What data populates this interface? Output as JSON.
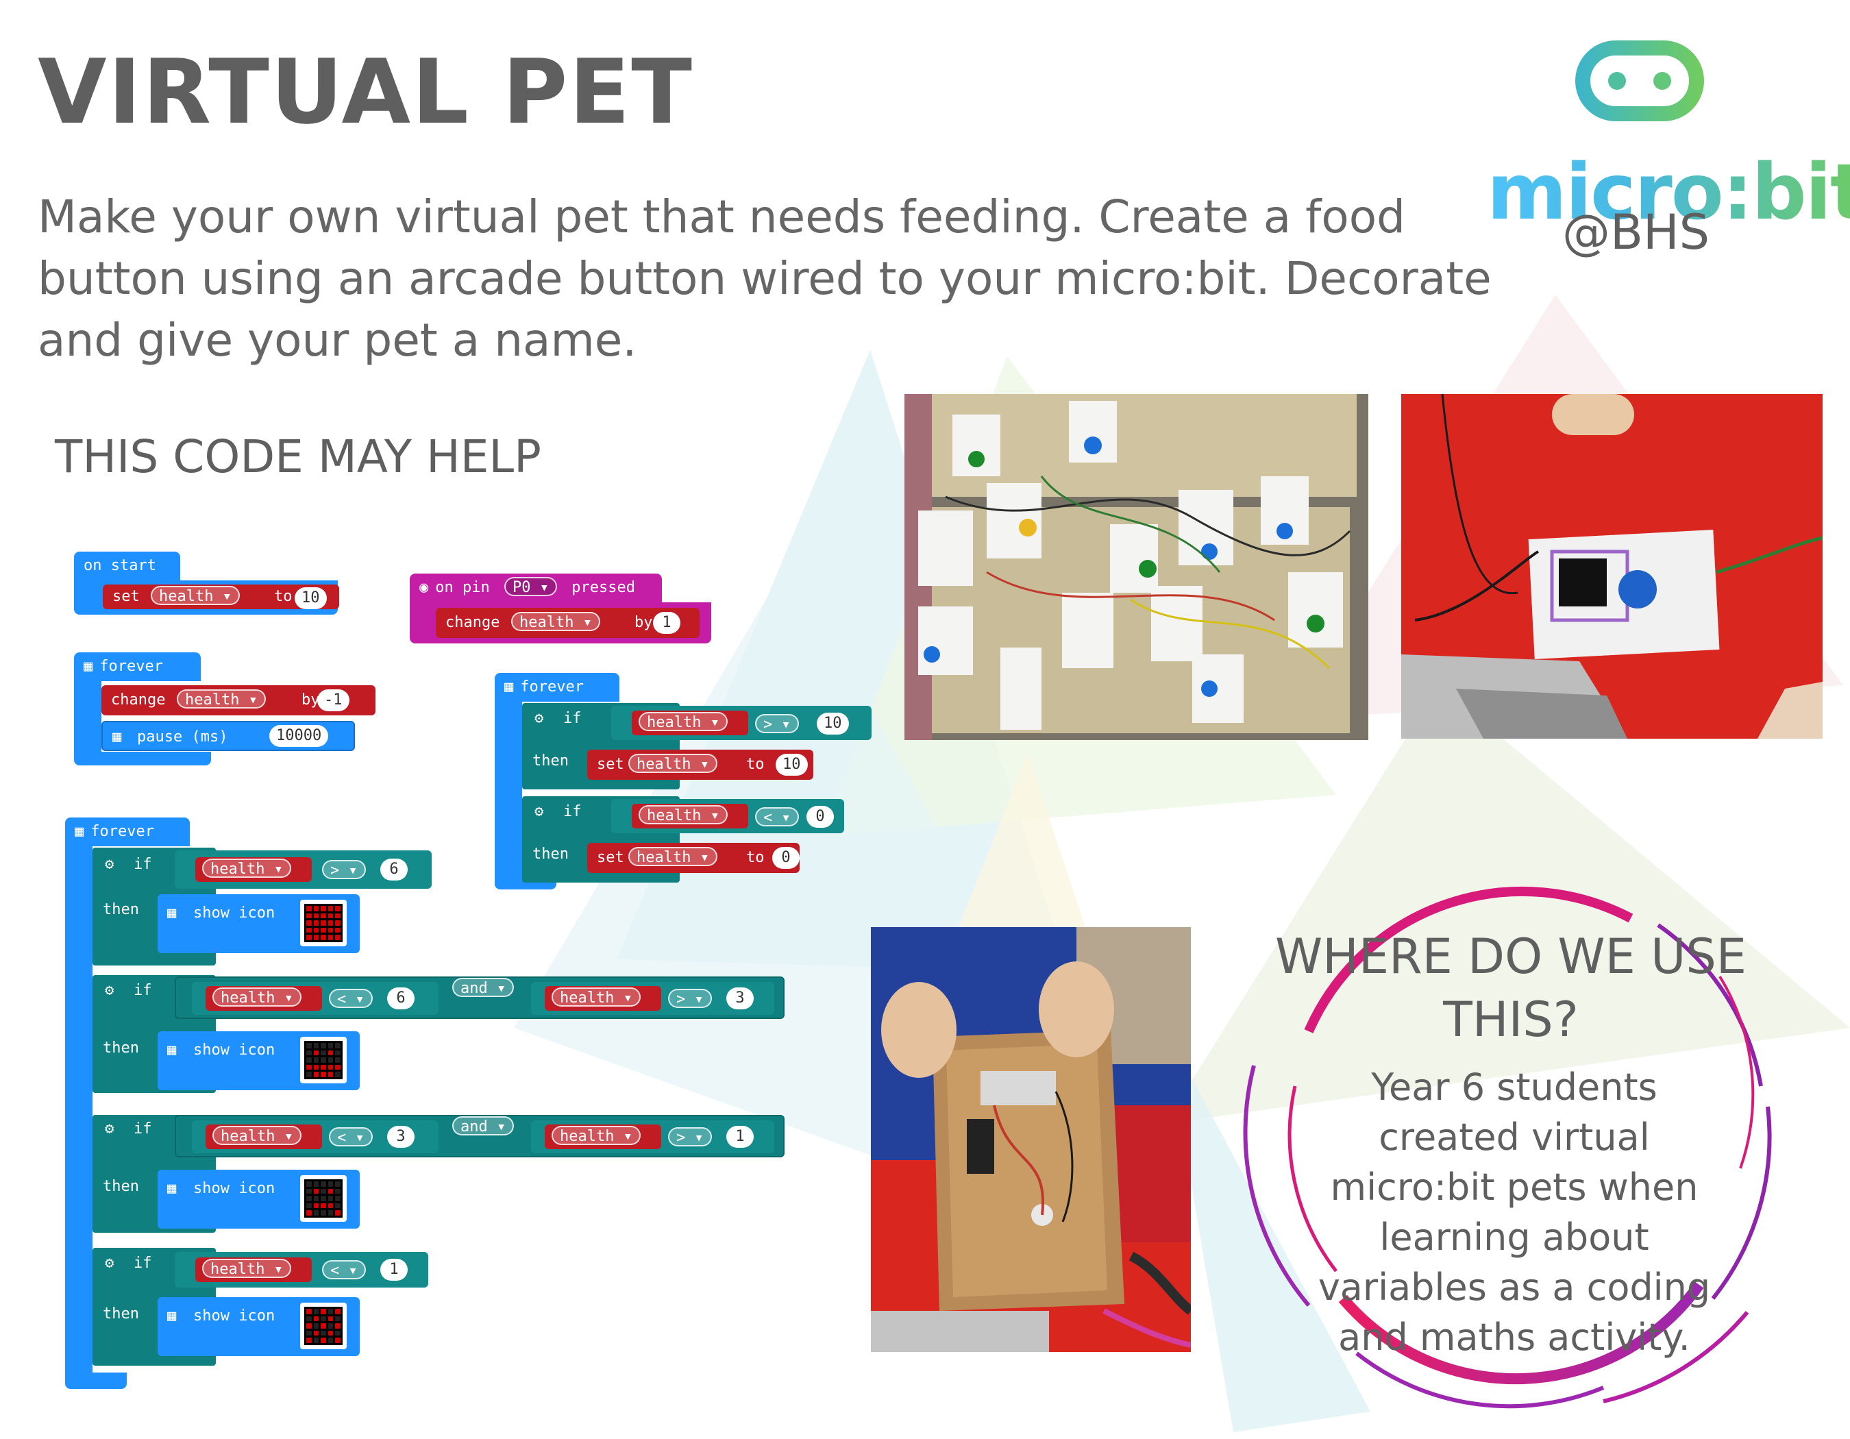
{
  "header": {
    "title": "VIRTUAL PET",
    "intro": "Make your own virtual pet that needs feeding. Create a food button using an arcade button wired to your micro:bit. Decorate and give your pet a name.",
    "help_heading": "THIS CODE MAY HELP"
  },
  "logo": {
    "wordmark": "micro:bit",
    "handle": "@BHS"
  },
  "code": {
    "on_start": {
      "hat": "on start",
      "set": "set",
      "var": "health ▾",
      "to": "to",
      "value": "10"
    },
    "forever_1": {
      "hat": "forever",
      "change": "change",
      "var": "health ▾",
      "by": "by",
      "value": "-1",
      "pause": "pause (ms)",
      "pause_value": "10000"
    },
    "on_pin": {
      "hat": "on pin",
      "pin": "P0 ▾",
      "pressed": "pressed",
      "change": "change",
      "var": "health ▾",
      "by": "by",
      "value": "1"
    },
    "forever_2": {
      "hat": "forever",
      "if1": {
        "if": "if",
        "var": "health ▾",
        "op": "> ▾",
        "value": "10",
        "then": "then",
        "set": "set",
        "set_var": "health ▾",
        "to": "to",
        "set_value": "10"
      },
      "if2": {
        "if": "if",
        "var": "health ▾",
        "op": "< ▾",
        "value": "0",
        "then": "then",
        "set": "set",
        "set_var": "health ▾",
        "to": "to",
        "set_value": "0"
      }
    },
    "forever_3": {
      "hat": "forever",
      "rows": [
        {
          "if": "if",
          "var": "health ▾",
          "op": "> ▾",
          "value": "6",
          "then": "then",
          "action": "show icon"
        },
        {
          "if": "if",
          "var": "health ▾",
          "op": "< ▾",
          "value": "6",
          "and": "and ▾",
          "var2": "health ▾",
          "op2": "> ▾",
          "value2": "3",
          "then": "then",
          "action": "show icon"
        },
        {
          "if": "if",
          "var": "health ▾",
          "op": "< ▾",
          "value": "3",
          "and": "and ▾",
          "var2": "health ▾",
          "op2": "> ▾",
          "value2": "1",
          "then": "then",
          "action": "show icon"
        },
        {
          "if": "if",
          "var": "health ▾",
          "op": "< ▾",
          "value": "1",
          "then": "then",
          "action": "show icon"
        }
      ]
    }
  },
  "photos": {
    "group": "photo-classroom-pets",
    "single": "photo-pet-on-table",
    "inside": "photo-inside-cardboard-box"
  },
  "callout": {
    "title": "WHERE DO WE USE THIS?",
    "text": "Year 6 students created virtual micro:bit pets when learning about variables as a coding and maths activity."
  },
  "colors": {
    "logic_teal": "#0f7f7f",
    "basic_blue": "#1e90ff",
    "variable_red": "#c11c24",
    "input_magenta": "#c41ea6",
    "logo_blue": "#4fc3f7",
    "logo_green": "#6fcb62",
    "ring_magenta": "#c2187a",
    "ring_purple": "#8e24aa"
  }
}
